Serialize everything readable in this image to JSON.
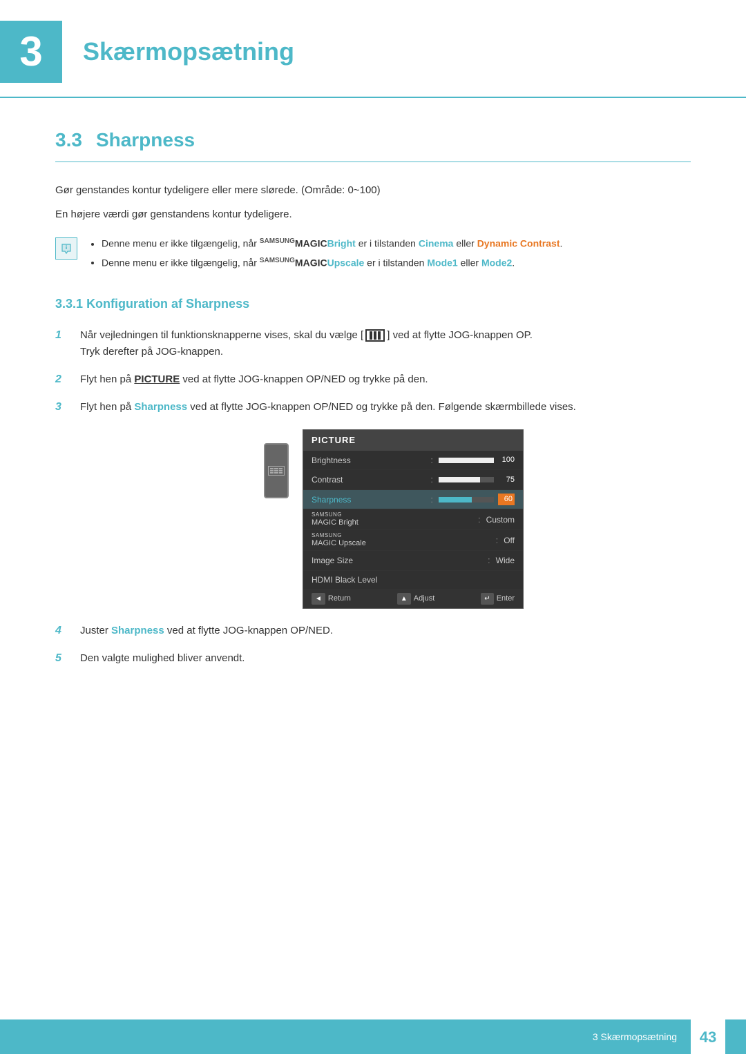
{
  "chapter": {
    "number": "3",
    "title": "Skærmopsætning"
  },
  "section": {
    "number": "3.3",
    "title": "Sharpness"
  },
  "subsection": {
    "number": "3.3.1",
    "title": "Konfiguration af Sharpness"
  },
  "body": {
    "paragraph1": "Gør genstandes kontur tydeligere eller mere slørede. (Område: 0~100)",
    "paragraph2": "En højere værdi gør genstandens kontur tydeligere."
  },
  "notes": {
    "note1": {
      "before": "Denne menu er ikke tilgængelig, når ",
      "brand": "SAMSUNG MAGIC",
      "keyword1": "Bright",
      "middle": " er i tilstanden ",
      "keyword2": "Cinema",
      "between": " eller ",
      "keyword3": "Dynamic Contrast",
      "after": "."
    },
    "note2": {
      "before": "Denne menu er ikke tilgængelig, når ",
      "brand": "SAMSUNG MAGIC",
      "keyword1": "Upscale",
      "middle": " er i tilstanden ",
      "keyword2": "Mode1",
      "between": " eller ",
      "keyword3": "Mode2",
      "after": "."
    }
  },
  "steps": [
    {
      "number": "1",
      "text_before": "Når vejledningen til funktionsknapperne vises, skal du vælge [",
      "bracket_content": "|||",
      "text_after": "] ved at flytte JOG-knappen OP.",
      "text_line2": "Tryk derefter på JOG-knappen."
    },
    {
      "number": "2",
      "text_before": "Flyt hen på ",
      "bold_word": "PICTURE",
      "text_after": " ved at flytte JOG-knappen OP/NED og trykke på den."
    },
    {
      "number": "3",
      "text_before": "Flyt hen på ",
      "bold_word": "Sharpness",
      "text_after": " ved at flytte JOG-knappen OP/NED og trykke på den. Følgende skærmbillede vises."
    },
    {
      "number": "4",
      "text_before": "Juster ",
      "bold_word": "Sharpness",
      "text_after": " ved at flytte JOG-knappen OP/NED."
    },
    {
      "number": "5",
      "text": "Den valgte mulighed bliver anvendt."
    }
  ],
  "osd_menu": {
    "title": "PICTURE",
    "items": [
      {
        "name": "Brightness",
        "value_type": "bar",
        "bar_percent": 100,
        "num": "100"
      },
      {
        "name": "Contrast",
        "value_type": "bar",
        "bar_percent": 75,
        "num": "75"
      },
      {
        "name": "Sharpness",
        "value_type": "bar_highlighted",
        "bar_percent": 60,
        "num": "60",
        "is_active": true
      },
      {
        "name": "SAMSUNG MAGIC Bright",
        "value_type": "text",
        "text_val": "Custom"
      },
      {
        "name": "SAMSUNG MAGIC Upscale",
        "value_type": "text",
        "text_val": "Off"
      },
      {
        "name": "Image Size",
        "value_type": "text",
        "text_val": "Wide"
      },
      {
        "name": "HDMI Black Level",
        "value_type": "empty"
      }
    ],
    "footer": {
      "return_label": "Return",
      "adjust_label": "Adjust",
      "enter_label": "Enter"
    }
  },
  "footer": {
    "chapter_label": "3 Skærmopsætning",
    "page_number": "43"
  }
}
